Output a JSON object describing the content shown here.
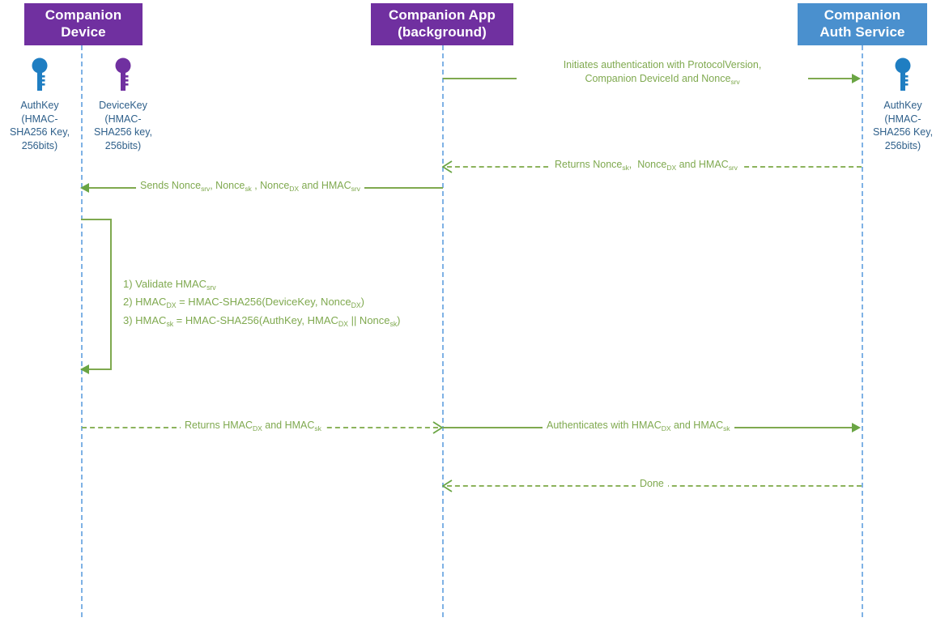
{
  "diagram": {
    "title": "Companion device authentication sequence",
    "type": "sequence-diagram",
    "colors": {
      "purple": "#7030A0",
      "blue": "#4A90CE",
      "lifeline": "#7FB2E5",
      "arrow_green": "#7FA94F",
      "key_blue": "#1F7EC2",
      "key_purple": "#7030A0",
      "caption_text": "#2E5F8A"
    }
  },
  "participants": [
    {
      "id": "device",
      "label": "Companion\nDevice",
      "header_color": "#7030A0"
    },
    {
      "id": "app",
      "label": "Companion App\n(background)",
      "header_color": "#7030A0"
    },
    {
      "id": "service",
      "label": "Companion\nAuth Service",
      "header_color": "#4A90CE"
    }
  ],
  "keys": [
    {
      "id": "device-authkey",
      "icon": "key-icon",
      "color": "#1F7EC2",
      "caption": "AuthKey\n(HMAC-\nSHA256 Key,\n256bits)"
    },
    {
      "id": "device-devicekey",
      "icon": "key-icon",
      "color": "#7030A0",
      "caption": "DeviceKey\n(HMAC-\nSHA256 key,\n256bits)"
    },
    {
      "id": "service-authkey",
      "icon": "key-icon",
      "color": "#1F7EC2",
      "caption": "AuthKey\n(HMAC-\nSHA256 Key,\n256bits)"
    }
  ],
  "messages": [
    {
      "id": "msg-initiate",
      "from": "app",
      "to": "service",
      "direction": "right",
      "style": "solid",
      "line1": "Initiates authentication with ProtocolVersion,",
      "line2_pre": "Companion DeviceId and Nonce",
      "line2_sub": "srv"
    },
    {
      "id": "msg-returns-nonces",
      "from": "service",
      "to": "app",
      "direction": "left",
      "style": "dashed",
      "parts": [
        {
          "text": "Returns Nonce"
        },
        {
          "sub": "sk"
        },
        {
          "text": ",  Nonce"
        },
        {
          "sub": "DX"
        },
        {
          "text": " and HMAC"
        },
        {
          "sub": "srv"
        }
      ]
    },
    {
      "id": "msg-sends-nonces",
      "from": "app",
      "to": "device",
      "direction": "left",
      "style": "solid",
      "parts": [
        {
          "text": "Sends Nonce"
        },
        {
          "sub": "srv"
        },
        {
          "text": ", Nonce"
        },
        {
          "sub": "sk"
        },
        {
          "text": " , Nonce"
        },
        {
          "sub": "DX"
        },
        {
          "text": " and HMAC"
        },
        {
          "sub": "srv"
        }
      ]
    },
    {
      "id": "msg-returns-hmacs",
      "from": "device",
      "to": "app",
      "direction": "right",
      "style": "dashed",
      "parts": [
        {
          "text": "Returns HMAC"
        },
        {
          "sub": "DX"
        },
        {
          "text": " and HMAC"
        },
        {
          "sub": "sk"
        }
      ]
    },
    {
      "id": "msg-authenticates",
      "from": "app",
      "to": "service",
      "direction": "right",
      "style": "solid",
      "parts": [
        {
          "text": "Authenticates with HMAC"
        },
        {
          "sub": "DX"
        },
        {
          "text": " and HMAC"
        },
        {
          "sub": "sk"
        }
      ]
    },
    {
      "id": "msg-done",
      "from": "service",
      "to": "app",
      "direction": "left",
      "style": "dashed",
      "parts": [
        {
          "text": "Done"
        }
      ]
    }
  ],
  "processing_note": {
    "id": "device-processing-steps",
    "lines": [
      {
        "parts": [
          {
            "text": "1) Validate HMAC"
          },
          {
            "sub": "srv"
          }
        ]
      },
      {
        "parts": [
          {
            "text": "2) HMAC"
          },
          {
            "sub": "DX"
          },
          {
            "text": " = HMAC-SHA256(DeviceKey, Nonce"
          },
          {
            "sub": "DX"
          },
          {
            "text": ")"
          }
        ]
      },
      {
        "parts": [
          {
            "text": "3) HMAC"
          },
          {
            "sub": "sk"
          },
          {
            "text": " = HMAC-SHA256(AuthKey, HMAC"
          },
          {
            "sub": "DX"
          },
          {
            "text": " || Nonce"
          },
          {
            "sub": "sk"
          },
          {
            "text": ")"
          }
        ]
      }
    ]
  }
}
